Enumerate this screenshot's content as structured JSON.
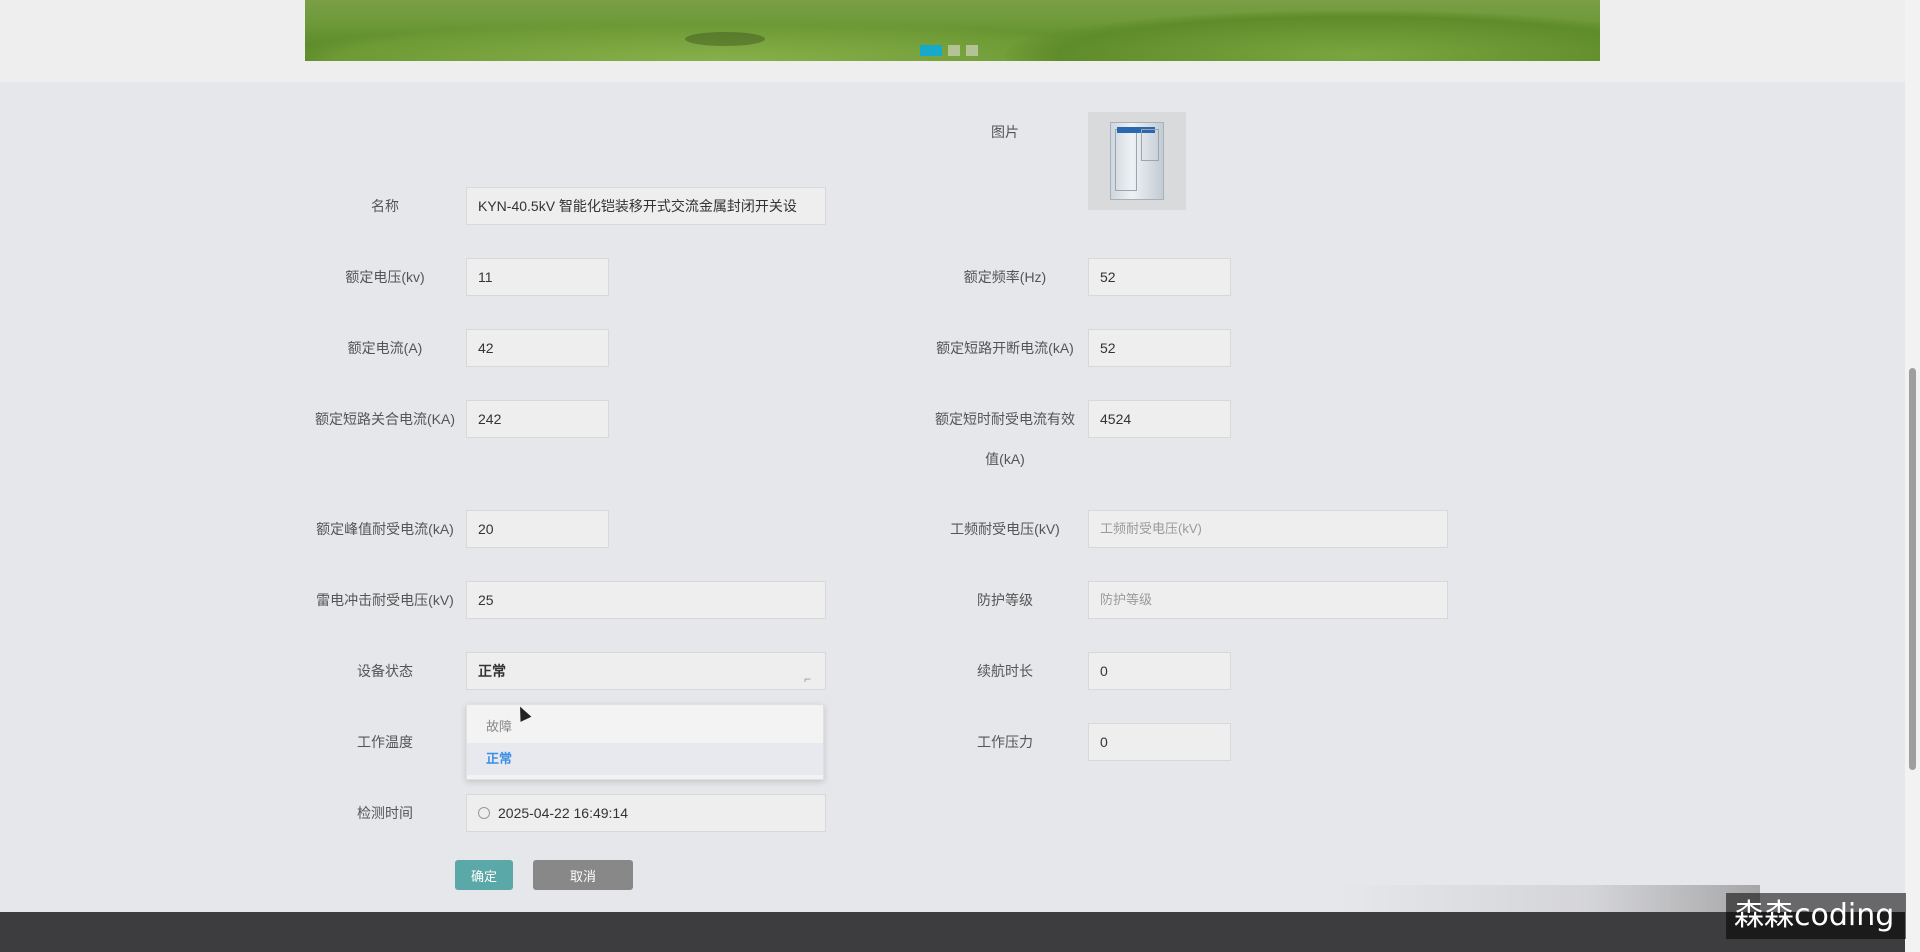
{
  "banner": {
    "slides": 3,
    "active_slide": 1
  },
  "form": {
    "picture_label": "图片",
    "name_label": "名称",
    "name_value": "KYN-40.5kV 智能化铠装移开式交流金属封闭开关设",
    "rated_voltage_label": "额定电压(kv)",
    "rated_voltage_value": "11",
    "rated_frequency_label": "额定频率(Hz)",
    "rated_frequency_value": "52",
    "rated_current_label": "额定电流(A)",
    "rated_current_value": "42",
    "rated_short_break_label": "额定短路开断电流(kA)",
    "rated_short_break_value": "52",
    "rated_short_make_label": "额定短路关合电流(KA)",
    "rated_short_make_value": "242",
    "rated_short_withstand_label_line1": "额定短时耐受电流有效",
    "rated_short_withstand_label_line2": "值(kA)",
    "rated_short_withstand_value": "4524",
    "rated_peak_label": "额定峰值耐受电流(kA)",
    "rated_peak_value": "20",
    "power_freq_label": "工频耐受电压(kV)",
    "power_freq_placeholder": "工频耐受电压(kV)",
    "lightning_label": "雷电冲击耐受电压(kV)",
    "lightning_value": "25",
    "protection_label": "防护等级",
    "protection_placeholder": "防护等级",
    "status_label": "设备状态",
    "status_value": "正常",
    "status_options": [
      "故障",
      "正常"
    ],
    "endurance_label": "续航时长",
    "endurance_value": "0",
    "work_temp_label": "工作温度",
    "work_pressure_label": "工作压力",
    "work_pressure_value": "0",
    "detect_time_label": "检测时间",
    "detect_time_value": "2025-04-22 16:49:14",
    "confirm_button": "确定",
    "cancel_button": "取消"
  },
  "watermark": "森森coding",
  "colors": {
    "accent": "#16a9c9",
    "confirm": "#5aa9a8",
    "cancel": "#888888",
    "selected_option": "#3a8ee6"
  }
}
